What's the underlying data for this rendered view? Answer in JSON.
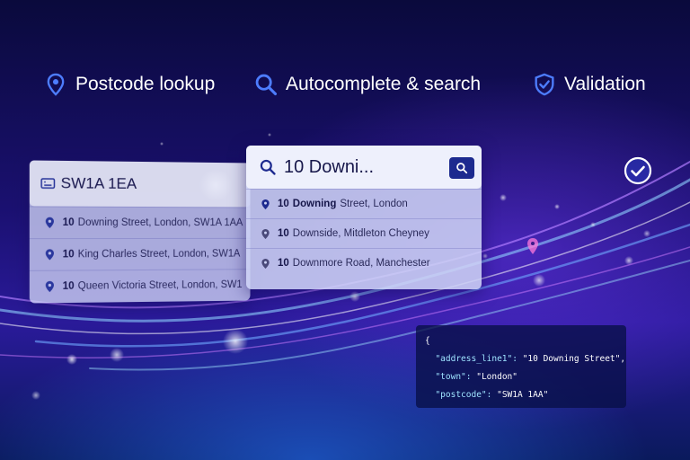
{
  "colors": {
    "accent": "#4d7dff",
    "code_key": "#9fe4ff",
    "background": "#1a1070"
  },
  "features": [
    {
      "label": "Postcode lookup",
      "icon": "location-pin-icon"
    },
    {
      "label": "Autocomplete & search",
      "icon": "search-icon"
    },
    {
      "label": "Validation",
      "icon": "shield-check-icon"
    }
  ],
  "postcode_panel": {
    "input_value": "SW1A 1EA",
    "results": [
      {
        "number": "10",
        "text": "Downing Street, London, SW1A 1AA"
      },
      {
        "number": "10",
        "text": "King Charles Street, London, SW1A"
      },
      {
        "number": "10",
        "text": "Queen Victoria Street, London, SW1"
      }
    ]
  },
  "search_panel": {
    "input_value": "10 Downi...",
    "results": [
      {
        "number": "10",
        "bold": "Downing",
        "text": "Street, London"
      },
      {
        "number": "10",
        "bold": "",
        "text": "Downside, Mitdleton Cheyney"
      },
      {
        "number": "10",
        "bold": "",
        "text": "Downmore Road, Manchester"
      }
    ]
  },
  "code_block": {
    "open": "{",
    "lines": [
      {
        "key": "\"address_line1\":",
        "value": "\"10 Downing Street\","
      },
      {
        "key": "\"town\":",
        "value": "\"London\""
      },
      {
        "key": "\"postcode\":",
        "value": "\"SW1A 1AA\""
      }
    ]
  }
}
